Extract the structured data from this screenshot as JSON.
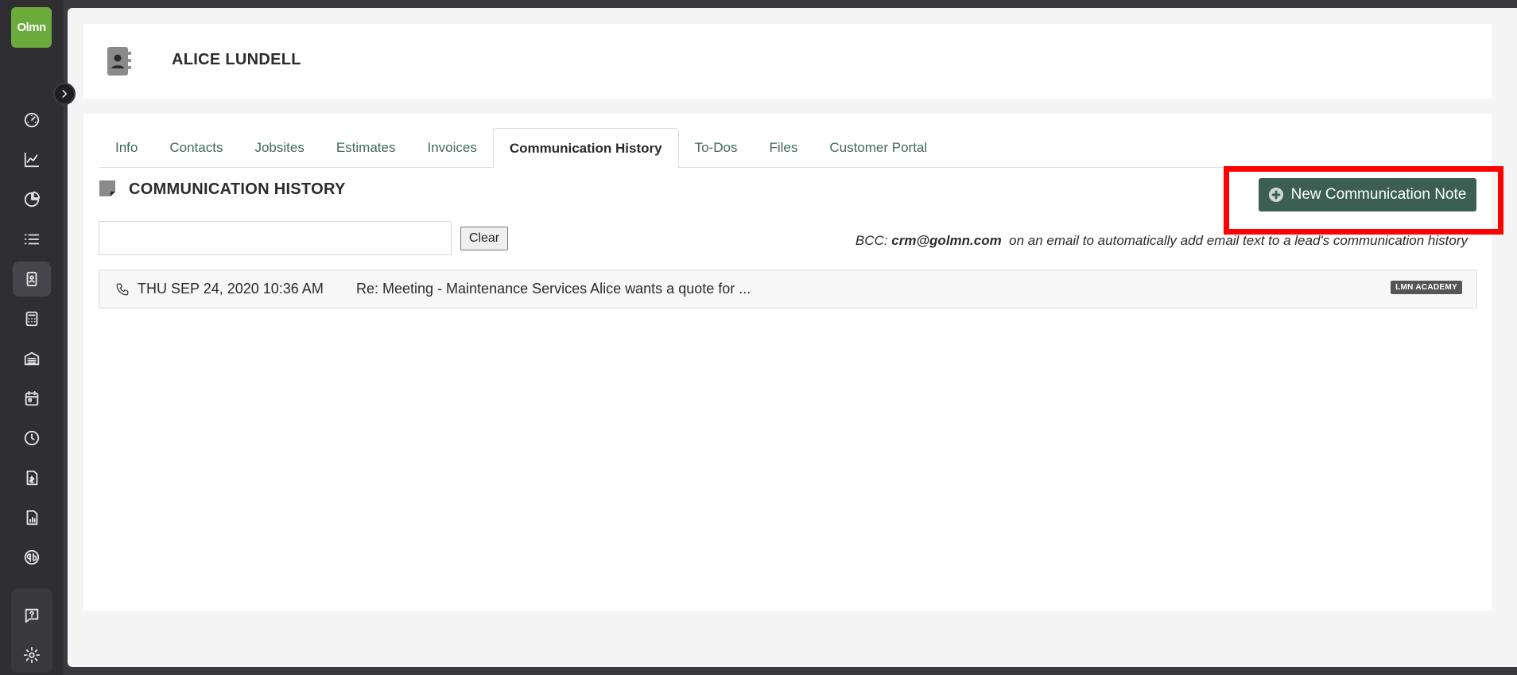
{
  "app": {
    "logo_text": "Olmn"
  },
  "sidebar": {
    "items": [
      {
        "icon": "dashboard-icon"
      },
      {
        "icon": "line-chart-icon"
      },
      {
        "icon": "pie-chart-icon"
      },
      {
        "icon": "list-icon"
      },
      {
        "icon": "contact-card-icon",
        "active": true
      },
      {
        "icon": "calculator-icon"
      },
      {
        "icon": "warehouse-icon"
      },
      {
        "icon": "calendar-icon"
      },
      {
        "icon": "clock-icon"
      },
      {
        "icon": "invoice-icon"
      },
      {
        "icon": "report-icon"
      },
      {
        "icon": "quickbooks-icon"
      },
      {
        "icon": "help-icon"
      },
      {
        "icon": "gear-icon"
      }
    ]
  },
  "header": {
    "customer_name": "ALICE LUNDELL"
  },
  "tabs": [
    {
      "label": "Info"
    },
    {
      "label": "Contacts"
    },
    {
      "label": "Jobsites"
    },
    {
      "label": "Estimates"
    },
    {
      "label": "Invoices"
    },
    {
      "label": "Communication History",
      "active": true
    },
    {
      "label": "To-Dos"
    },
    {
      "label": "Files"
    },
    {
      "label": "Customer Portal"
    }
  ],
  "section": {
    "title": "COMMUNICATION HISTORY",
    "new_note_label": "New Communication Note",
    "search_value": "",
    "clear_label": "Clear",
    "bcc_prefix": "BCC:",
    "bcc_email": "crm@golmn.com",
    "bcc_suffix": "on an email to automatically add email text to a lead's communication history"
  },
  "history": [
    {
      "date": "THU SEP 24, 2020 10:36 AM",
      "subject": "Re: Meeting - Maintenance Services Alice wants a quote for ...",
      "badge": "LMN ACADEMY",
      "type_icon": "phone-icon"
    }
  ],
  "colors": {
    "brand_green": "#6aab3c",
    "primary_button": "#3b5f53",
    "highlight": "#ff0000",
    "sidebar_bg": "#2f2f33"
  }
}
